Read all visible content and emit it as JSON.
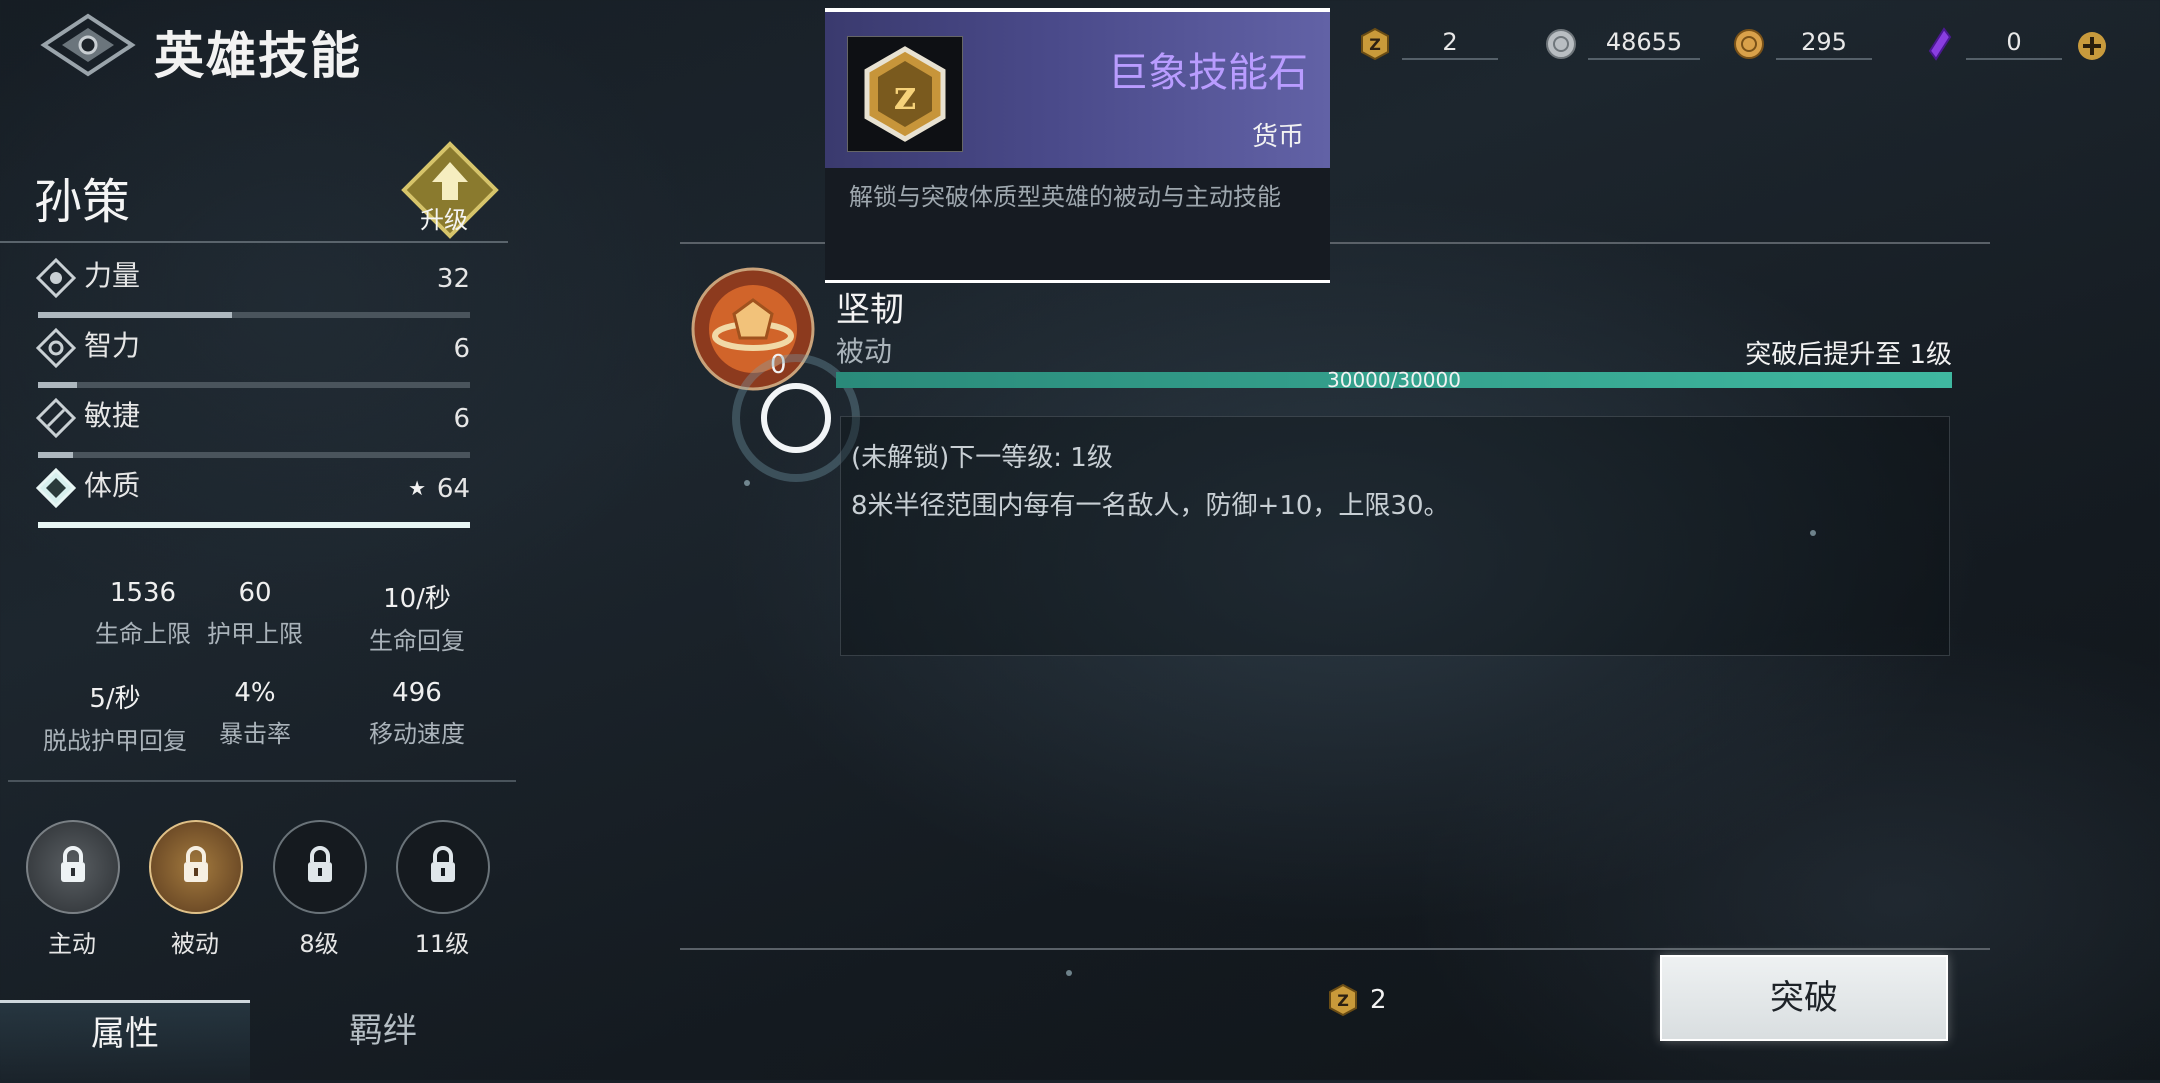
{
  "header": {
    "title": "英雄技能"
  },
  "currencies": [
    {
      "icon": "skill-stone-icon",
      "value": "2"
    },
    {
      "icon": "silver-coin-icon",
      "value": "48655"
    },
    {
      "icon": "gold-coin-icon",
      "value": "295"
    },
    {
      "icon": "purple-crystal-icon",
      "value": "0"
    }
  ],
  "hero": {
    "name": "孙策",
    "upgrade_label": "升级",
    "attributes": [
      {
        "icon": "strength-icon",
        "name": "力量",
        "value": "32",
        "fill": 0.45
      },
      {
        "icon": "intelligence-icon",
        "name": "智力",
        "value": "6",
        "fill": 0.09
      },
      {
        "icon": "agility-icon",
        "name": "敏捷",
        "value": "6",
        "fill": 0.08
      },
      {
        "icon": "constitution-icon",
        "name": "体质",
        "value": "64",
        "fill": 1.0,
        "starred": true
      }
    ],
    "stats": [
      {
        "value": "1536",
        "label": "生命上限"
      },
      {
        "value": "60",
        "label": "护甲上限"
      },
      {
        "value": "10/秒",
        "label": "生命回复"
      },
      {
        "value": "5/秒",
        "label": "脱战护甲回复"
      },
      {
        "value": "4%",
        "label": "暴击率"
      },
      {
        "value": "496",
        "label": "移动速度"
      }
    ]
  },
  "skill_slots": [
    {
      "label": "主动",
      "icon": "lock-icon"
    },
    {
      "label": "被动",
      "icon": "lock-icon"
    },
    {
      "label": "8级",
      "icon": "lock-icon"
    },
    {
      "label": "11级",
      "icon": "lock-icon"
    }
  ],
  "tabs": [
    {
      "label": "属性",
      "active": true
    },
    {
      "label": "羁绊",
      "active": false
    }
  ],
  "tooltip": {
    "title": "巨象技能石",
    "type": "货币",
    "description": "解锁与突破体质型英雄的被动与主动技能"
  },
  "skill": {
    "name": "坚韧",
    "type": "被动",
    "count": "0",
    "breakthrough_note": "突破后提升至 1级",
    "progress_text": "30000/30000",
    "progress": 1.0,
    "next_level": "(未解锁)下一等级: 1级",
    "effect": "8米半径范围内每有一名敌人，防御+10，上限30。"
  },
  "cost": {
    "icon": "skill-stone-icon",
    "value": "2"
  },
  "action": {
    "label": "突破"
  },
  "colors": {
    "accent_teal": "#3fb8a0",
    "tooltip_title": "#b99cff",
    "tooltip_bg": "#4a4a8a"
  }
}
